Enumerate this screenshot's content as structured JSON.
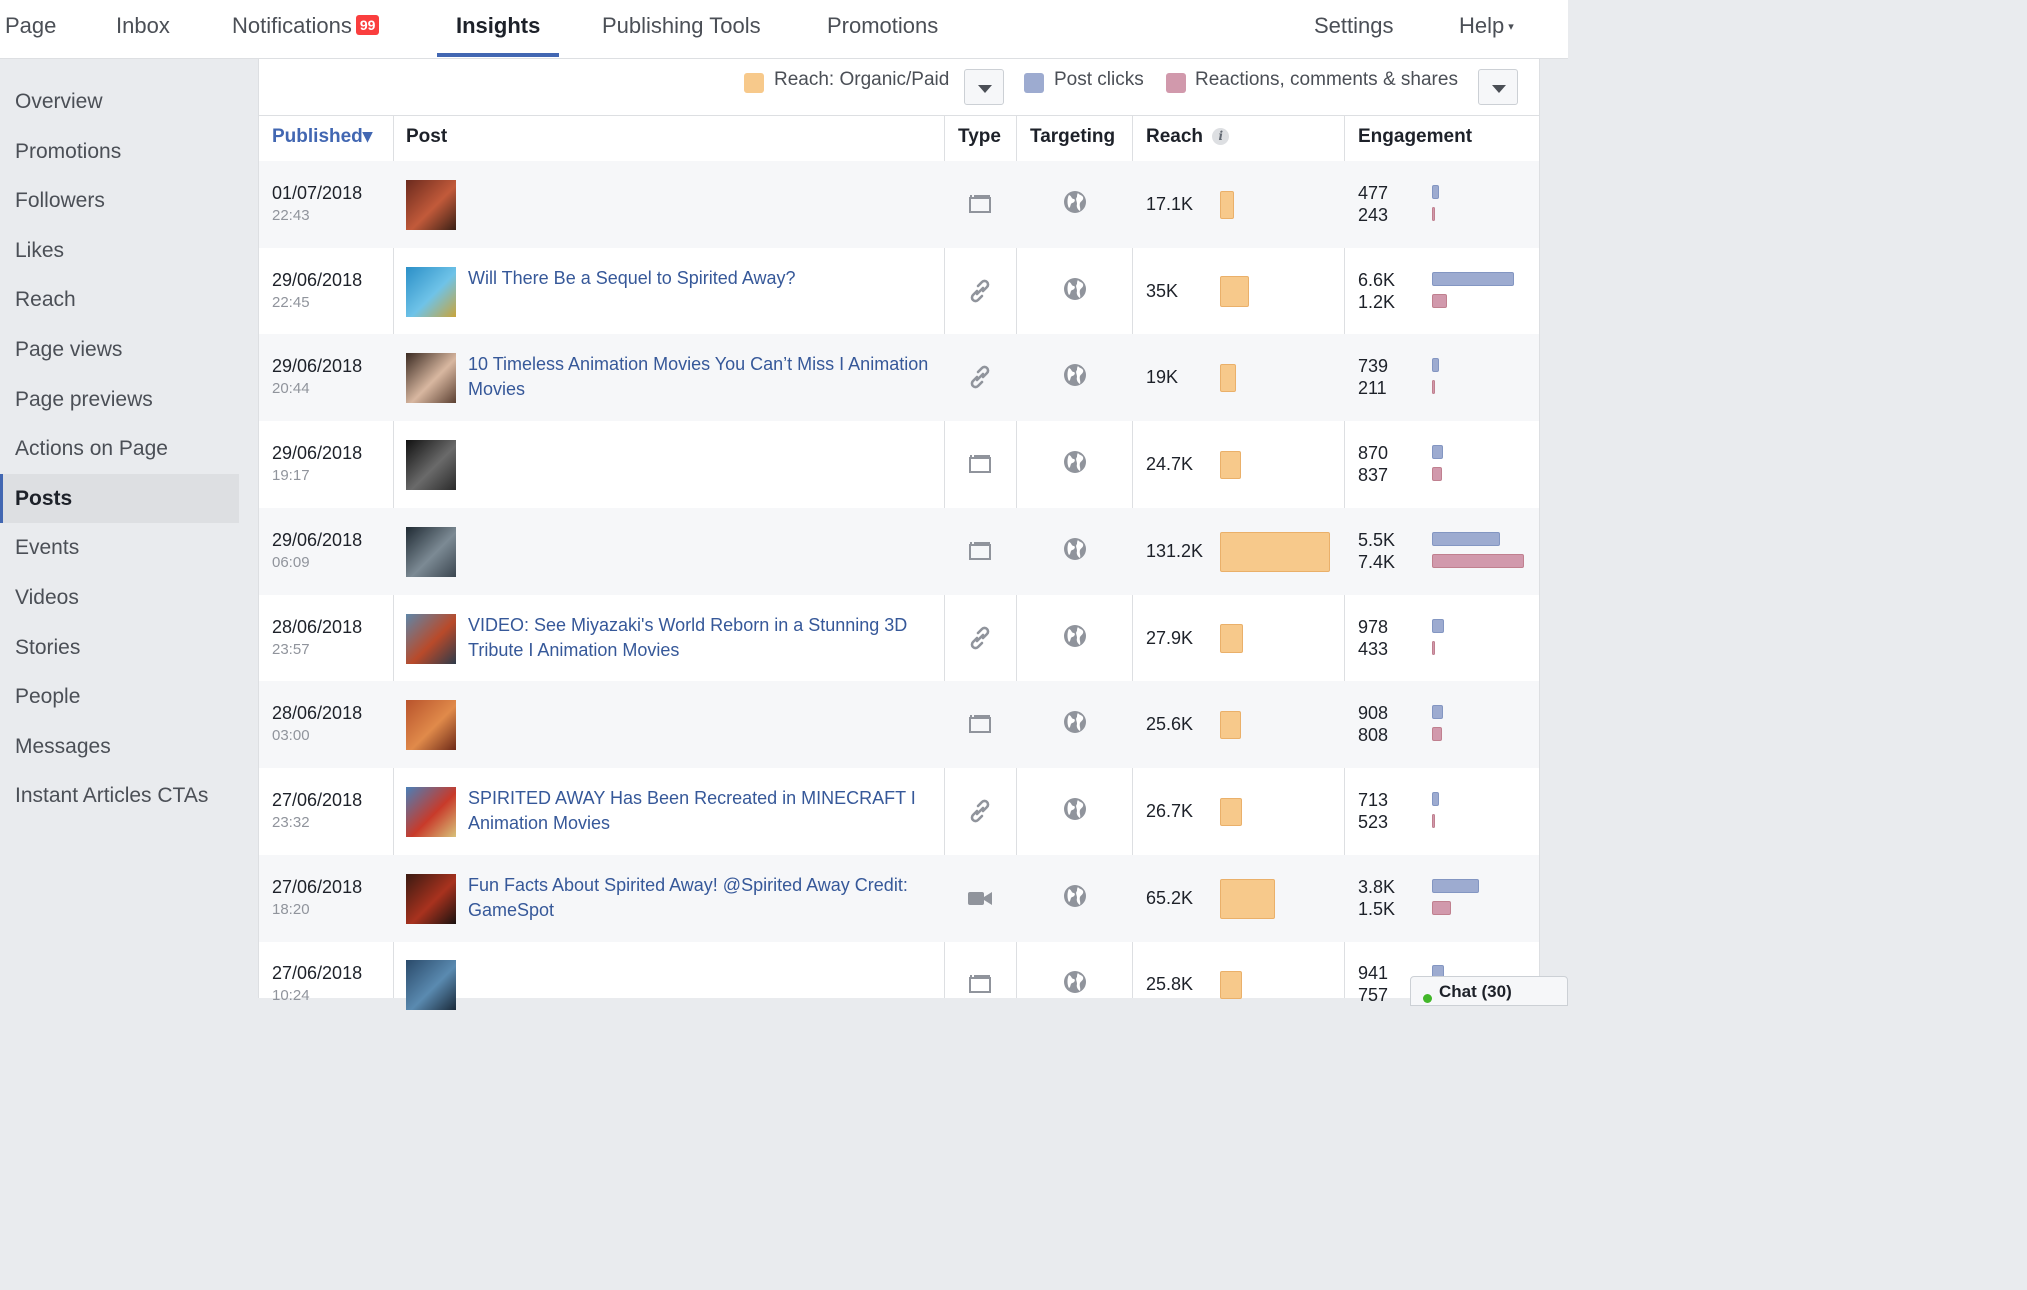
{
  "nav": {
    "tabs": [
      {
        "label": "Page"
      },
      {
        "label": "Inbox"
      },
      {
        "label": "Notifications",
        "badge": "99"
      },
      {
        "label": "Insights"
      },
      {
        "label": "Publishing Tools"
      },
      {
        "label": "Promotions"
      }
    ],
    "right": [
      {
        "label": "Settings"
      },
      {
        "label": "Help"
      }
    ],
    "help_caret": "▾",
    "active_tab": "Insights"
  },
  "sidebar": {
    "items": [
      {
        "label": "Overview"
      },
      {
        "label": "Promotions"
      },
      {
        "label": "Followers"
      },
      {
        "label": "Likes"
      },
      {
        "label": "Reach"
      },
      {
        "label": "Page views"
      },
      {
        "label": "Page previews"
      },
      {
        "label": "Actions on Page"
      },
      {
        "label": "Posts"
      },
      {
        "label": "Events"
      },
      {
        "label": "Videos"
      },
      {
        "label": "Stories"
      },
      {
        "label": "People"
      },
      {
        "label": "Messages"
      },
      {
        "label": "Instant Articles CTAs"
      }
    ],
    "active": "Posts"
  },
  "legend": {
    "reach": "Reach: Organic/Paid",
    "clicks": "Post clicks",
    "reactions": "Reactions, comments & shares"
  },
  "colors": {
    "reach": "#f7c98b",
    "clicks": "#9dabd0",
    "reactions": "#d199ac",
    "accent": "#4267b2",
    "link": "#365899"
  },
  "table": {
    "headers": {
      "published": "Published",
      "sort_caret": "▾",
      "post": "Post",
      "type": "Type",
      "targeting": "Targeting",
      "reach": "Reach",
      "reach_info": "i",
      "engagement": "Engagement"
    },
    "reach_max_value": 131.2,
    "engagement_max_value": 7.4,
    "rows": [
      {
        "date": "01/07/2018",
        "time": "22:43",
        "title": "",
        "type": "photo-icon",
        "targeting": "globe-icon",
        "reach": "17.1K",
        "reach_value": 17.1,
        "clicks": "477",
        "reactions": "243",
        "clicks_value": 0.477,
        "reactions_value": 0.243,
        "thumb": [
          "#6b2a1e",
          "#c25a3a",
          "#3a2016"
        ]
      },
      {
        "date": "29/06/2018",
        "time": "22:45",
        "title": "Will There Be a Sequel to Spirited Away?",
        "type": "link-icon",
        "targeting": "globe-icon",
        "reach": "35K",
        "reach_value": 35,
        "clicks": "6.6K",
        "reactions": "1.2K",
        "clicks_value": 6.6,
        "reactions_value": 1.2,
        "thumb": [
          "#2b8fc7",
          "#6fc3e8",
          "#c9a43a"
        ]
      },
      {
        "date": "29/06/2018",
        "time": "20:44",
        "title": "10 Timeless Animation Movies You Can’t Miss I Animation Movies",
        "type": "link-icon",
        "targeting": "globe-icon",
        "reach": "19K",
        "reach_value": 19,
        "clicks": "739",
        "reactions": "211",
        "clicks_value": 0.739,
        "reactions_value": 0.211,
        "thumb": [
          "#3a2a22",
          "#d8b7a0",
          "#5b4032"
        ]
      },
      {
        "date": "29/06/2018",
        "time": "19:17",
        "title": "",
        "type": "photo-icon",
        "targeting": "globe-icon",
        "reach": "24.7K",
        "reach_value": 24.7,
        "clicks": "870",
        "reactions": "837",
        "clicks_value": 0.87,
        "reactions_value": 0.837,
        "thumb": [
          "#111111",
          "#6a6a6a",
          "#2a2a2a"
        ]
      },
      {
        "date": "29/06/2018",
        "time": "06:09",
        "title": "",
        "type": "photo-icon",
        "targeting": "globe-icon",
        "reach": "131.2K",
        "reach_value": 131.2,
        "clicks": "5.5K",
        "reactions": "7.4K",
        "clicks_value": 5.5,
        "reactions_value": 7.4,
        "thumb": [
          "#1f2a33",
          "#7c8a94",
          "#3b4650"
        ]
      },
      {
        "date": "28/06/2018",
        "time": "23:57",
        "title": "VIDEO: See Miyazaki's World Reborn in a Stunning 3D Tribute I Animation Movies",
        "type": "link-icon",
        "targeting": "globe-icon",
        "reach": "27.9K",
        "reach_value": 27.9,
        "clicks": "978",
        "reactions": "433",
        "clicks_value": 0.978,
        "reactions_value": 0.433,
        "thumb": [
          "#5f86a8",
          "#b94a2a",
          "#2d3b4a"
        ]
      },
      {
        "date": "28/06/2018",
        "time": "03:00",
        "title": "",
        "type": "photo-icon",
        "targeting": "globe-icon",
        "reach": "25.6K",
        "reach_value": 25.6,
        "clicks": "908",
        "reactions": "808",
        "clicks_value": 0.908,
        "reactions_value": 0.808,
        "thumb": [
          "#b8532c",
          "#e08a4a",
          "#6e2a18"
        ]
      },
      {
        "date": "27/06/2018",
        "time": "23:32",
        "title": "SPIRITED AWAY Has Been Recreated in MINECRAFT I Animation Movies",
        "type": "link-icon",
        "targeting": "globe-icon",
        "reach": "26.7K",
        "reach_value": 26.7,
        "clicks": "713",
        "reactions": "523",
        "clicks_value": 0.713,
        "reactions_value": 0.523,
        "thumb": [
          "#4a7fb8",
          "#c83a2a",
          "#d8c27a"
        ]
      },
      {
        "date": "27/06/2018",
        "time": "18:20",
        "title": "Fun Facts About Spirited Away! @Spirited Away Credit: GameSpot",
        "type": "video-icon",
        "targeting": "globe-icon",
        "reach": "65.2K",
        "reach_value": 65.2,
        "clicks": "3.8K",
        "reactions": "1.5K",
        "clicks_value": 3.8,
        "reactions_value": 1.5,
        "thumb": [
          "#3a1a12",
          "#a8321e",
          "#1a1210"
        ]
      },
      {
        "date": "27/06/2018",
        "time": "10:24",
        "title": "",
        "type": "photo-icon",
        "targeting": "globe-icon",
        "reach": "25.8K",
        "reach_value": 25.8,
        "clicks": "941",
        "reactions": "757",
        "clicks_value": 0.941,
        "reactions_value": 0.757,
        "thumb": [
          "#2a4a6a",
          "#5a8ab0",
          "#1a2a3a"
        ]
      }
    ]
  },
  "chat": {
    "label": "Chat (30)"
  }
}
